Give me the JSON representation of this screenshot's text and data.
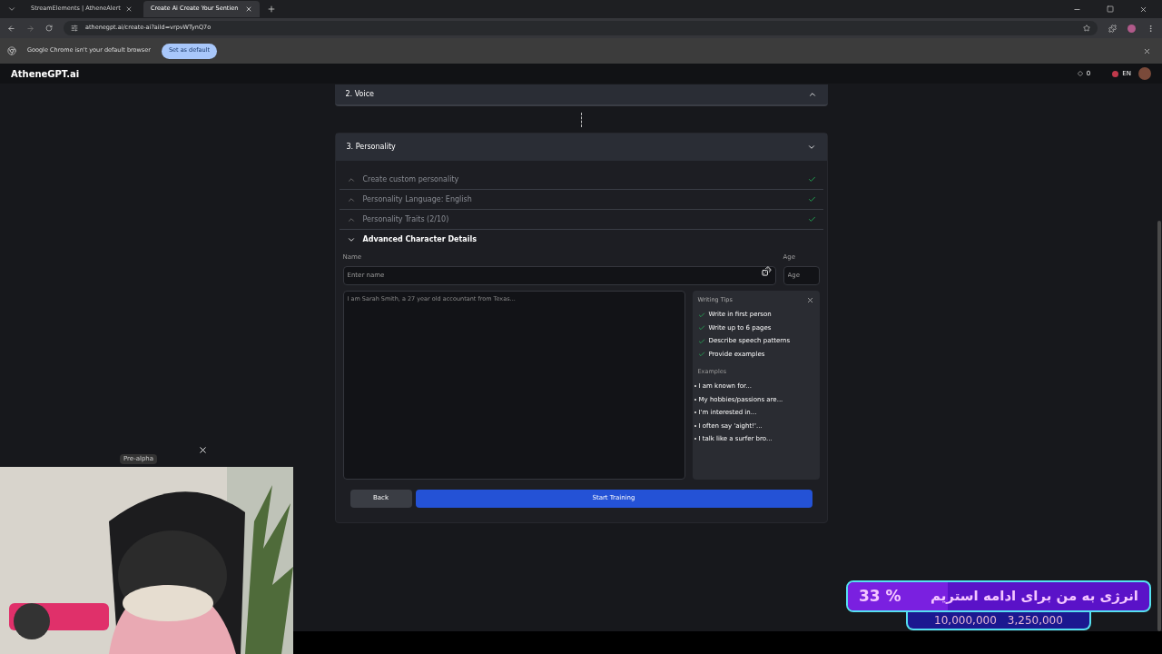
{
  "browser": {
    "tabs": [
      {
        "title": "StreamElements | AtheneAlert",
        "selected": false
      },
      {
        "title": "Create Ai Create Your Sentien",
        "selected": true
      }
    ],
    "url": "athenegpt.ai/create-ai?aiId=vrpvWTynQ7o",
    "infobar": {
      "message": "Google Chrome isn't your default browser",
      "button": "Set as default"
    }
  },
  "app": {
    "logo": "AtheneGPT.ai",
    "credits": "0",
    "language": "EN"
  },
  "sections": [
    {
      "title": "2. Voice",
      "expanded": false
    },
    {
      "title": "3. Personality",
      "expanded": true
    }
  ],
  "steps": [
    {
      "label": "Create custom personality",
      "done": true,
      "expanded": false
    },
    {
      "label": "Personality Language: English",
      "done": true,
      "expanded": false
    },
    {
      "label": "Personality Traits (2/10)",
      "done": true,
      "expanded": false
    },
    {
      "label": "Advanced Character Details",
      "done": false,
      "expanded": true
    }
  ],
  "form": {
    "name_label": "Name",
    "name_placeholder": "Enter name",
    "age_label": "Age",
    "age_placeholder": "Age",
    "description_placeholder": "I am Sarah Smith, a 27 year old accountant from Texas..."
  },
  "tips": {
    "title": "Writing Tips",
    "items": [
      "Write in first person",
      "Write up to 6 pages",
      "Describe speech patterns",
      "Provide examples"
    ],
    "examples_title": "Examples",
    "examples": [
      "I am known for...",
      "My hobbies/passions are...",
      "I'm interested in...",
      "I often say 'aight!'...",
      "I talk like a surfer bro..."
    ]
  },
  "buttons": {
    "back": "Back",
    "start": "Start Training"
  },
  "overlay": {
    "webcam_badge": "Pre-alpha",
    "donation": {
      "percent": "33 %",
      "message": "انرژی به من برای ادامه استریم",
      "goal": "10,000,000",
      "current": "3,250,000",
      "level": 0.33
    }
  }
}
